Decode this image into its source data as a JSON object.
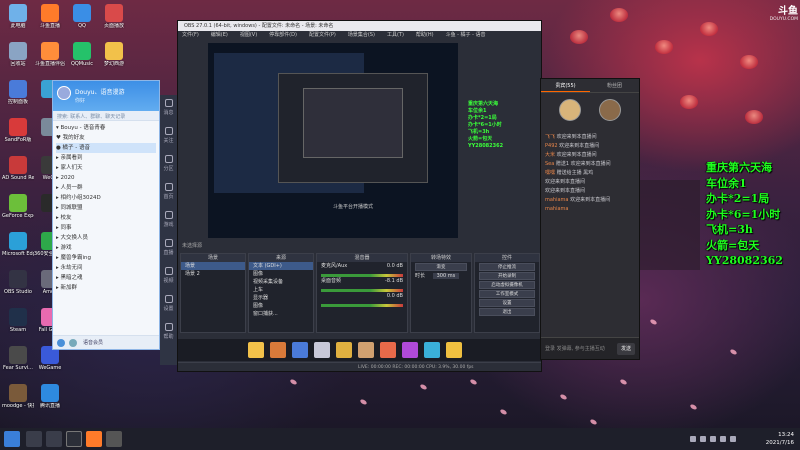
{
  "watermark": {
    "logo": "斗鱼",
    "sub": "DOUYU.COM"
  },
  "desktop_icons": [
    {
      "label": "此电脑",
      "color": "#6fb1e9"
    },
    {
      "label": "斗鱼直播",
      "color": "#ff7b2a"
    },
    {
      "label": "QQ",
      "color": "#3a8ee6"
    },
    {
      "label": "页面播放",
      "color": "#d94a4a"
    },
    {
      "label": "回收站",
      "color": "#8aa4c4"
    },
    {
      "label": "斗鱼直播伴侣",
      "color": "#ff8d3a"
    },
    {
      "label": "QQMusic",
      "color": "#25c26a"
    },
    {
      "label": "梦幻西游",
      "color": "#f2c14a"
    },
    {
      "label": "控制面板",
      "color": "#4a7bd9"
    },
    {
      "label": "",
      "color": "#3aa2d4"
    },
    {
      "label": "SandFoR版",
      "color": "#d83a3a"
    },
    {
      "label": "",
      "color": "#7a8a9a"
    },
    {
      "label": "AD Sound Recorder",
      "color": "#c83a3a"
    },
    {
      "label": "WeGa",
      "color": "#3a3a3a"
    },
    {
      "label": "GeForce Experience",
      "color": "#6cbf3a"
    },
    {
      "label": "",
      "color": "#2a2a2a"
    },
    {
      "label": "Microsoft Edge",
      "color": "#2ba0d8"
    },
    {
      "label": "360安全浏览器",
      "color": "#2ea84a"
    },
    {
      "label": "OBS Studio",
      "color": "#333344"
    },
    {
      "label": "Amon",
      "color": "#6a6a7a"
    },
    {
      "label": "Steam",
      "color": "#20304a"
    },
    {
      "label": "Fall Guys",
      "color": "#e86ab0"
    },
    {
      "label": "Fear Survi...",
      "color": "#4a4a4a"
    },
    {
      "label": "WeGame",
      "color": "#3a5ad9"
    },
    {
      "label": "moodge - 快捷方式",
      "color": "#7a5a3a"
    },
    {
      "label": "腾讯直播",
      "color": "#2e8ae0"
    }
  ],
  "qq": {
    "name": "Douyu、语音漫游",
    "signature": "你好",
    "search_placeholder": "搜索: 联系人、群聊、聊天记录",
    "rows": [
      "▾ Bouyu - 语音青春",
      "  ♥ 我的好友",
      "  ● 橘子 - 语音",
      "▸ 亲属看到",
      "▸ 家人们天",
      "▸ 2020",
      "▸ 人员一群",
      "▸ 相约小组3024D",
      "▸ 同城联盟",
      "▸ 校友",
      "▸ 同事",
      "▸ 大交换人员",
      "▸ 游戏",
      "▸ 魔兽争霸ing",
      "▸ 永劫无间",
      "▸ 黑暗之魂",
      "▸ 新加群"
    ],
    "footer": "语音会员"
  },
  "dock_items": [
    "消息",
    "关注",
    "分区",
    "首页",
    "游戏",
    "直播",
    "视频",
    "设置",
    "帮助"
  ],
  "obs": {
    "title": "OBS 27.0.1 (64-bit, windows) - 配置文件: 未命名 - 场景: 未命名",
    "menu": [
      "文件(F)",
      "编辑(E)",
      "视图(V)",
      "停靠部件(D)",
      "配置文件(P)",
      "场景集合(S)",
      "工具(T)",
      "帮助(H)",
      "斗鱼 - 橘子 - 语音"
    ],
    "preview_text": "斗鱼平台开播模式",
    "overlay_lines": [
      "重庆第六天海",
      "车位余1",
      "办卡*2=1局",
      "办卡*6=1小时",
      "飞机=3h",
      "火箭=包天",
      "YY28082362"
    ],
    "dock_label": "未选择源",
    "scenes_header": "场景",
    "scenes": [
      "场景",
      "场景 2"
    ],
    "sources_header": "来源",
    "sources": [
      "文本 (GDI+)",
      "图像",
      "视频采集设备",
      "上车",
      "显示器",
      "图像",
      "窗口捕获..."
    ],
    "mixer_header": "混音器",
    "mixer_tracks": [
      {
        "name": "麦克风/Aux",
        "db": "0.0 dB"
      },
      {
        "name": "桌面音频",
        "db": "-8.1 dB"
      },
      {
        "name": "",
        "db": "0.0 dB"
      }
    ],
    "transitions_header": "转场特效",
    "transition_value": "渐变",
    "duration_label": "时长",
    "duration_value": "300 ms",
    "controls_header": "控件",
    "controls": [
      "停止推流",
      "开始录制",
      "启动虚拟摄像机",
      "工作室模式",
      "设置",
      "退出"
    ],
    "status": "LIVE: 00:00:00  REC: 00:00:00  CPU: 3.9%, 30.00 fps"
  },
  "chat": {
    "tabs": [
      "贵宾(55)",
      "粉丝团"
    ],
    "messages": [
      {
        "user": "飞飞",
        "text": "欢迎来到本直播间"
      },
      {
        "user": "P492",
        "text": "欢迎来到本直播间"
      },
      {
        "user": "大米",
        "text": "欢迎来到本直播间"
      },
      {
        "user": "Sea",
        "text": "赠送1 欢迎来到本直播间"
      },
      {
        "user": "嘿嘿",
        "text": "赠送给主播 黑鸡"
      },
      {
        "user": "",
        "text": "欢迎来到本直播间"
      },
      {
        "user": "",
        "text": "欢迎来到本直播间"
      },
      {
        "user": "mahiama",
        "text": "欢迎来到本直播间"
      },
      {
        "user": "mahiama",
        "text": ""
      }
    ],
    "input_placeholder": "登录 发弹幕, 参与主播互动",
    "send": "发送"
  },
  "big_overlay": [
    "重庆第六天海",
    "车位余1",
    "办卡*2=1局",
    "办卡*6=1小时",
    "飞机=3h",
    "火箭=包天",
    "YY28082362"
  ],
  "taskbar": {
    "time": "13:24",
    "date": "2021/7/16"
  }
}
